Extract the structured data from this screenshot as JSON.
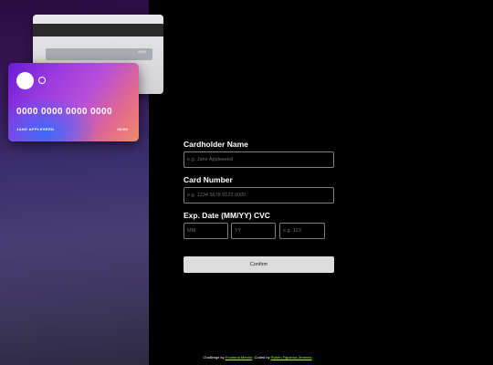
{
  "card_back": {
    "cvc": "000"
  },
  "card_front": {
    "number": "0000 0000 0000 0000",
    "holder": "JANE APPLESEED",
    "expiry": "00/00"
  },
  "form": {
    "cardholder": {
      "label": "Cardholder Name",
      "placeholder": "e.g. Jane Appleseed",
      "value": ""
    },
    "number": {
      "label": "Card Number",
      "placeholder": "e.g. 1234 5678 9123 0000",
      "value": ""
    },
    "exp_cvc_label": "Exp. Date (MM/YY) CVC",
    "month": {
      "placeholder": "MM",
      "value": ""
    },
    "year": {
      "placeholder": "YY",
      "value": ""
    },
    "cvc": {
      "placeholder": "e.g. 123",
      "value": ""
    },
    "confirm_label": "Confirm"
  },
  "footer": {
    "prefix": "Challenge by",
    "link1": "Frontend Mentor",
    "middle": ". Coded by",
    "link2": "Ruben Figueroa Jimenez",
    "suffix": "."
  }
}
